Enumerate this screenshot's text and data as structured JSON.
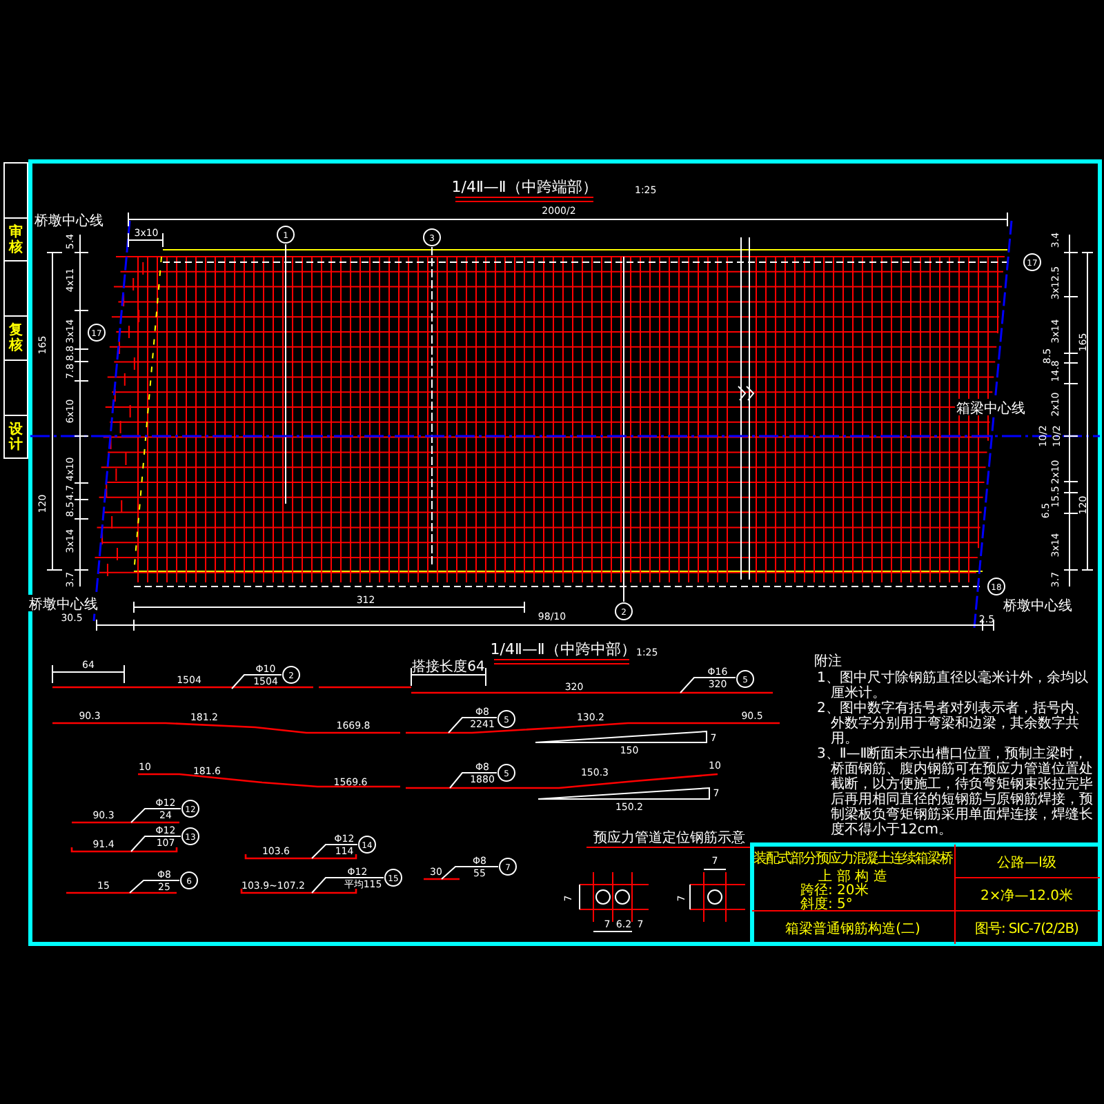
{
  "sidebar": [
    "审核",
    "复核",
    "设计"
  ],
  "section_end": {
    "title": "1/4Ⅱ—Ⅱ（中跨端部）",
    "scale": "1:25",
    "top_dims": [
      "2000/2",
      "3x10"
    ],
    "left_dims": [
      "5.4",
      "4x11",
      "3x14",
      "8.8",
      "7.8",
      "6x10",
      "4x10",
      "4.7",
      "8.5",
      "3x14",
      "3.7",
      "165",
      "120"
    ],
    "right_dims": [
      "3.4",
      "3x12.5",
      "3x14",
      "8.5",
      "14.8",
      "2x10",
      "10/2",
      "10/2",
      "2x10",
      "15.5",
      "6.5",
      "3x14",
      "3.7",
      "165",
      "120"
    ],
    "bottom_dims": [
      "312",
      "30.5",
      "98/10",
      "2.5"
    ],
    "callouts": [
      "1",
      "3",
      "17",
      "17",
      "2",
      "18"
    ],
    "labels": [
      "桥墩中心线",
      "桥墩中心线",
      "箱梁中心线",
      "桥墩中心线"
    ]
  },
  "section_mid": {
    "title": "1/4Ⅱ—Ⅱ（中跨中部）",
    "scale": "1:25"
  },
  "bars": [
    {
      "callout": "2",
      "dia": "Φ10",
      "length": "1504",
      "texts": [
        "64",
        "1504"
      ]
    },
    {
      "callout": "5",
      "dia": "Φ16",
      "length": "320",
      "texts": [
        "搭接长度64",
        "320"
      ]
    },
    {
      "callout": "5",
      "dia": "Φ8",
      "length": "2241",
      "texts": [
        "90.3",
        "181.2",
        "1669.8",
        "130.2",
        "90.5",
        "7",
        "150"
      ]
    },
    {
      "callout": "5",
      "dia": "Φ8",
      "length": "1880",
      "texts": [
        "10",
        "181.6",
        "1569.6",
        "150.3",
        "10",
        "7",
        "150.2"
      ]
    },
    {
      "callout": "12",
      "dia": "Φ12",
      "length": "24",
      "texts": [
        "90.3"
      ]
    },
    {
      "callout": "13",
      "dia": "Φ12",
      "length": "107",
      "texts": [
        "91.4"
      ]
    },
    {
      "callout": "14",
      "dia": "Φ12",
      "length": "114",
      "texts": [
        "103.6"
      ]
    },
    {
      "callout": "6",
      "dia": "Φ8",
      "length": "25",
      "texts": [
        "15"
      ]
    },
    {
      "callout": "15",
      "dia": "Φ12",
      "length": "平均115",
      "texts": [
        "103.9~107.2"
      ]
    },
    {
      "callout": "7",
      "dia": "Φ8",
      "length": "55",
      "texts": [
        "30"
      ]
    }
  ],
  "duct_detail": {
    "title": "预应力管道定位钢筋示意",
    "dims": [
      "7",
      "7",
      "6.2",
      "7",
      "7",
      "7"
    ]
  },
  "notes": {
    "title": "附注",
    "items": [
      "1、图中尺寸除钢筋直径以毫米计外，余均以厘米计。",
      "2、图中数字有括号者对列表示者，括号内、外数字分别用于弯梁和边梁，其余数字共用。",
      "3、Ⅱ—Ⅱ断面未示出槽口位置，预制主梁时，桥面钢筋、腹内钢筋可在预应力管道位置处截断，以方便施工，待负弯矩钢束张拉完毕后再用相同直径的短钢筋与原钢筋焊接，预制梁板负弯矩钢筋采用单面焊连接，焊缝长度不得小于12cm。"
    ]
  },
  "title_block": {
    "project": "装配式部分预应力混凝土连续箱梁桥",
    "part": "上 部 构 造",
    "span": "跨径: 20米",
    "skew": "斜度: 5°",
    "drawing": "箱梁普通钢筋构造(二)",
    "load": "公路—I级",
    "width": "2×净—12.0米",
    "number": "图号: SIC-7(2/2B)"
  }
}
